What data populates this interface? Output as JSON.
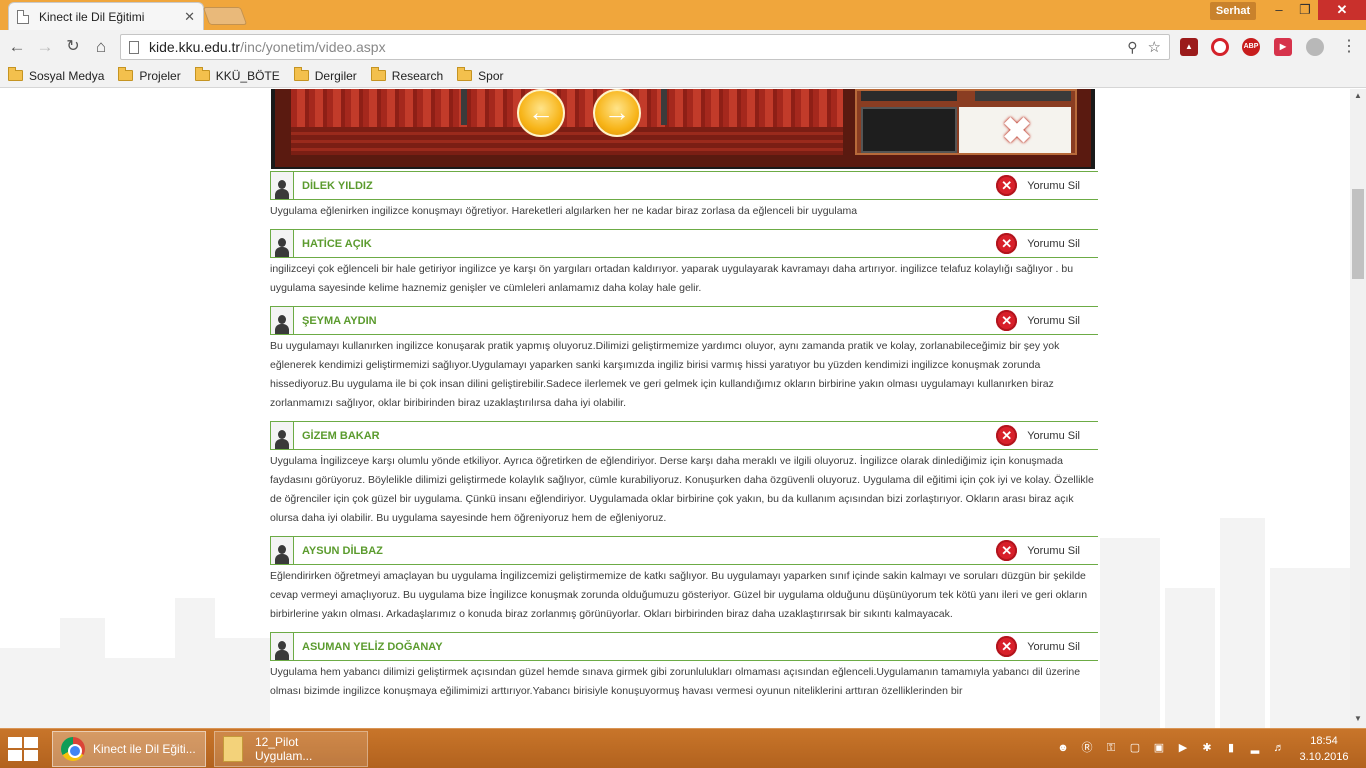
{
  "browser": {
    "tab_title": "Kinect ile Dil Eğitimi",
    "tab_close": "✕",
    "profile_name": "Serhat",
    "url_host": "kide.kku.edu.tr",
    "url_path": "/inc/yonetim/video.aspx",
    "bookmarks": [
      "Sosyal Medya",
      "Projeler",
      "KKÜ_BÖTE",
      "Dergiler",
      "Research",
      "Spor"
    ],
    "extensions": [
      "pdf-icon",
      "opera-icon",
      "adblock-icon",
      "red-extension-icon",
      "gray-extension-icon"
    ],
    "abp_label": "ABP"
  },
  "comments": [
    {
      "name": "DİLEK YILDIZ",
      "delete_label": "Yorumu Sil",
      "text": "Uygulama eğlenirken ingilizce konuşmayı öğretiyor. Hareketleri algılarken her ne kadar biraz zorlasa da eğlenceli bir uygulama"
    },
    {
      "name": "HATİCE AÇIK",
      "delete_label": "Yorumu Sil",
      "text": "ingilizceyi çok eğlenceli bir hale getiriyor ingilizce ye karşı ön yargıları ortadan kaldırıyor. yaparak uygulayarak kavramayı daha artırıyor. ingilizce telafuz kolaylığı sağlıyor . bu uygulama sayesinde kelime haznemiz genişler ve cümleleri anlamamız daha kolay hale gelir."
    },
    {
      "name": "ŞEYMA AYDIN",
      "delete_label": "Yorumu Sil",
      "text": "Bu uygulamayı kullanırken ingilizce konuşarak pratik yapmış oluyoruz.Dilimizi geliştirmemize yardımcı oluyor, aynı zamanda pratik ve kolay, zorlanabileceğimiz bir şey yok eğlenerek kendimizi geliştirmemizi sağlıyor.Uygulamayı yaparken sanki karşımızda ingiliz birisi varmış hissi yaratıyor bu yüzden kendimizi ingilizce konuşmak zorunda hissediyoruz.Bu uygulama ile bi çok insan dilini geliştirebilir.Sadece ilerlemek ve geri gelmek için kullandığımız okların birbirine yakın olması uygulamayı kullanırken biraz zorlanmamızı sağlıyor, oklar biribirinden biraz uzaklaştırılırsa daha iyi olabilir."
    },
    {
      "name": "GİZEM BAKAR",
      "delete_label": "Yorumu Sil",
      "text": "Uygulama İngilizceye karşı olumlu yönde etkiliyor. Ayrıca öğretirken de eğlendiriyor. Derse karşı daha meraklı ve ilgili oluyoruz. İngilizce olarak dinlediğimiz için konuşmada faydasını görüyoruz. Böylelikle dilimizi geliştirmede kolaylık sağlıyor, cümle kurabiliyoruz. Konuşurken daha özgüvenli oluyoruz. Uygulama dil eğitimi için çok iyi ve kolay. Özellikle de öğrenciler için çok güzel bir uygulama. Çünkü insanı eğlendiriyor. Uygulamada oklar birbirine çok yakın, bu da kullanım açısından bizi zorlaştırıyor. Okların arası biraz açık olursa daha iyi olabilir. Bu uygulama sayesinde hem öğreniyoruz hem de eğleniyoruz."
    },
    {
      "name": "AYSUN DİLBAZ",
      "delete_label": "Yorumu Sil",
      "text": "Eğlendirirken öğretmeyi amaçlayan bu uygulama İngilizcemizi geliştirmemize de katkı sağlıyor. Bu uygulamayı yaparken sınıf içinde sakin kalmayı ve soruları düzgün bir şekilde cevap vermeyi amaçlıyoruz. Bu uygulama bize İngilizce konuşmak zorunda olduğumuzu gösteriyor. Güzel bir uygulama olduğunu düşünüyorum tek kötü yanı ileri ve geri okların birbirlerine yakın olması. Arkadaşlarımız o konuda biraz zorlanmış görünüyorlar. Okları birbirinden biraz daha uzaklaştırırsak bir sıkıntı kalmayacak."
    },
    {
      "name": "ASUMAN YELİZ DOĞANAY",
      "delete_label": "Yorumu Sil",
      "text": "Uygulama hem yabancı dilimizi geliştirmek açısından güzel hemde sınava girmek gibi zorunlulukları olmaması açısından eğlenceli.Uygulamanın tamamıyla yabancı dil üzerine olması bizimde ingilizce konuşmaya eğilimimizi arttırıyor.Yabancı birisiyle konuşuyormuş havası vermesi oyunun niteliklerini arttıran özelliklerinden bir"
    }
  ],
  "taskbar": {
    "chrome_task": "Kinect ile Dil Eğiti...",
    "folder_task": "12_Pilot Uygulam...",
    "time": "18:54",
    "date": "3.10.2016"
  },
  "colors": {
    "titlebar": "#f0a63c",
    "accent_green": "#5b9b2e",
    "delete_red": "#d8202a",
    "taskbar": "#b8691f"
  }
}
